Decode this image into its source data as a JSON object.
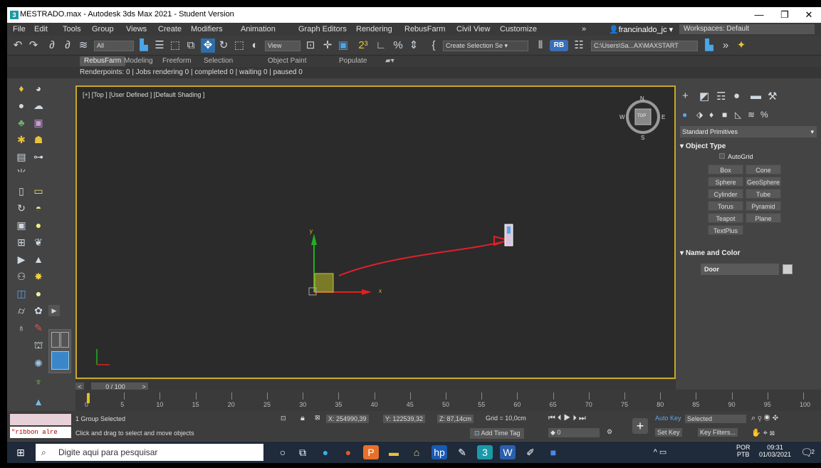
{
  "titlebar": {
    "title": "MESTRADO.max - Autodesk 3ds Max 2021 - Student Version",
    "min": "—",
    "max": "❐",
    "close": "✕"
  },
  "menu": {
    "items": [
      "File",
      "Edit",
      "Tools",
      "Group",
      "Views",
      "Create",
      "Modifiers",
      "Animation",
      "Graph Editors",
      "Rendering",
      "RebusFarm",
      "Civil View",
      "Customize"
    ],
    "more": "»",
    "user": "francinaldo_jc ▾",
    "workspaces": "Workspaces: Default"
  },
  "toolbar": {
    "filter": "All",
    "view": "View",
    "selection_set": "Create Selection Se ▾",
    "rb": "RB",
    "path": "C:\\Users\\Sa...AX\\MAXSTART"
  },
  "ribbon": {
    "tabs": [
      "RebusFarm",
      "Modeling",
      "Freeform",
      "Selection",
      "Object Paint",
      "Populate"
    ],
    "active": 0
  },
  "renderinfo": "Renderpoints: 0 | Jobs rendering 0 | completed 0 | waiting 0 | paused 0",
  "viewport": {
    "label": "[+] [Top ] [User Defined ] [Default Shading ]",
    "axis_x": "x",
    "axis_y": "y",
    "compass_n": "N",
    "compass_s": "S",
    "compass_e": "E",
    "compass_w": "W",
    "cube": "TOP"
  },
  "command_panel": {
    "dropdown": "Standard Primitives",
    "object_type_header": "Object Type",
    "autogrid": "AutoGrid",
    "buttons": [
      "Box",
      "Cone",
      "Sphere",
      "GeoSphere",
      "Cylinder",
      "Tube",
      "Torus",
      "Pyramid",
      "Teapot",
      "Plane",
      "TextPlus"
    ],
    "name_color_header": "Name and Color",
    "name_value": "Door"
  },
  "timeline": {
    "slider": "0 / 100",
    "ticks": [
      "0",
      "5",
      "10",
      "15",
      "20",
      "25",
      "30",
      "35",
      "40",
      "45",
      "50",
      "55",
      "60",
      "65",
      "70",
      "75",
      "80",
      "85",
      "90",
      "95",
      "100"
    ]
  },
  "status": {
    "script_text": "\"ribbon alre",
    "selected": "1 Group Selected",
    "prompt": "Click and drag to select and move objects",
    "x": "X: 254990,39",
    "y": "Y: 122539,32",
    "z": "Z: 87,14cm",
    "grid": "Grid = 10,0cm",
    "add_time_tag": "Add Time Tag",
    "auto_key": "Auto Key",
    "selected_dd": "Selected",
    "set_key": "Set Key",
    "key_filters": "Key Filters...",
    "frame": "0"
  },
  "taskbar": {
    "search_placeholder": "Digite aqui para pesquisar",
    "lang": "POR",
    "lang2": "PTB",
    "time": "09:31",
    "date": "01/03/2021",
    "notif": "2"
  }
}
